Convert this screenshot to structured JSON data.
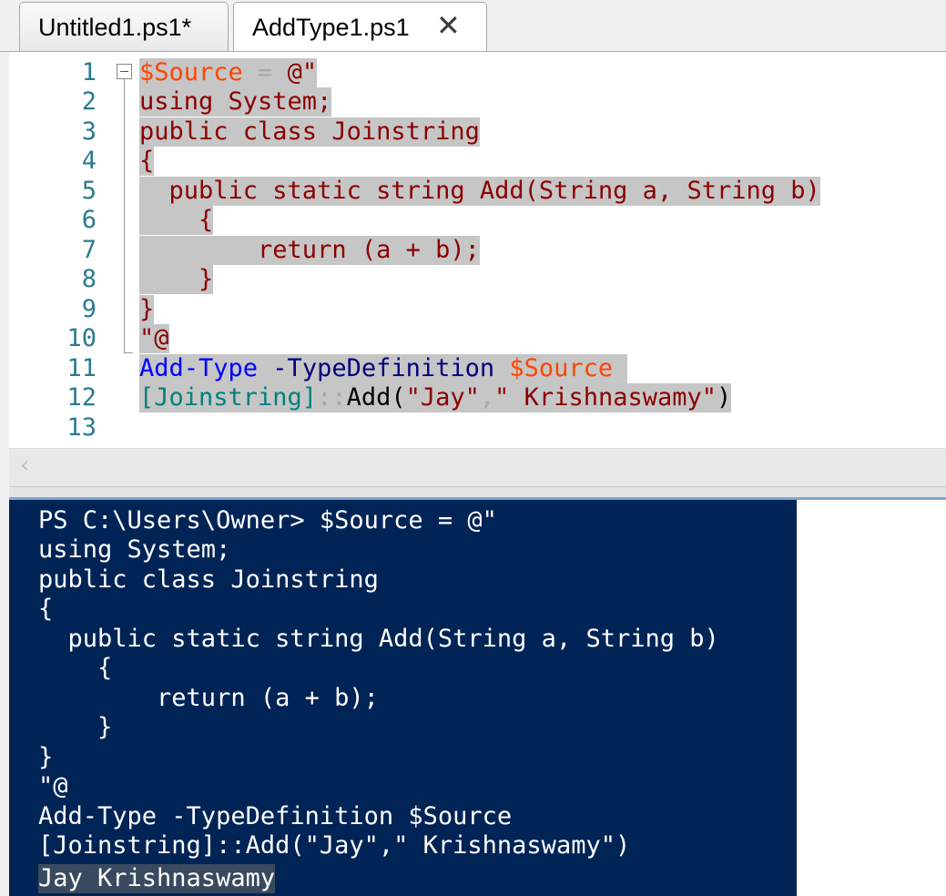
{
  "tabs": [
    {
      "label": "Untitled1.ps1*",
      "active": false
    },
    {
      "label": "AddType1.ps1",
      "active": true,
      "close_glyph": "✕"
    }
  ],
  "editor": {
    "line_numbers": [
      "1",
      "2",
      "3",
      "4",
      "5",
      "6",
      "7",
      "8",
      "9",
      "10",
      "11",
      "12",
      "13"
    ],
    "lines": [
      "$Source = @\"",
      "using System;",
      "public class Joinstring",
      "{",
      "  public static string Add(String a, String b)",
      "    {",
      "        return (a + b);",
      "    }",
      "}",
      "\"@",
      "Add-Type -TypeDefinition $Source",
      "[Joinstring]::Add(\"Jay\",\" Krishnaswamy\")",
      ""
    ],
    "tokens": {
      "l1_var": "$Source",
      "l1_eq": " = ",
      "l1_str": "@\"",
      "l11_cmd": "Add-Type",
      "l11_param": " -TypeDefinition",
      "l11_var": " $Source",
      "l12_type": "[Joinstring]",
      "l12_sep": "::",
      "l12_method": "Add(",
      "l12_s1": "\"Jay\"",
      "l12_comma": ",",
      "l12_s2": "\" Krishnaswamy\"",
      "l12_close": ")"
    },
    "scroll_left_glyph": "‹"
  },
  "console": {
    "lines": [
      "PS C:\\Users\\Owner> $Source = @\"",
      "using System;",
      "public class Joinstring",
      "{",
      "  public static string Add(String a, String b)",
      "    {",
      "        return (a + b);",
      "    }",
      "}",
      "\"@",
      "Add-Type -TypeDefinition $Source",
      "[Joinstring]::Add(\"Jay\",\" Krishnaswamy\")"
    ],
    "output": "Jay Krishnaswamy"
  },
  "colors": {
    "console_bg": "#012456",
    "string": "#8b0000",
    "command": "#0000ff",
    "parameter": "#000080",
    "variable": "#ff4500",
    "type": "#008080",
    "selection": "#c6c6c6"
  }
}
